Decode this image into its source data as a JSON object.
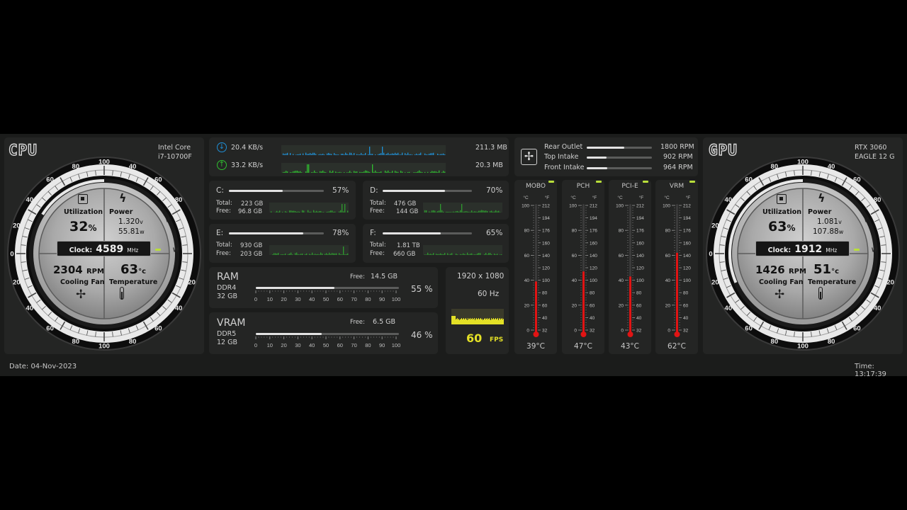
{
  "cpu": {
    "logo": "CPU",
    "model_line1": "Intel Core",
    "model_line2": "i7-10700F",
    "util_label": "Utilization",
    "util_value": "32",
    "util_unit": "%",
    "util_fraction": 0.32,
    "power_label": "Power",
    "voltage": "1.320",
    "voltage_unit": "v",
    "watts": "55.81",
    "watts_unit": "w",
    "clock_label": "Clock:",
    "clock_value": "4589",
    "clock_unit": "MHz",
    "fan_value": "2304",
    "fan_unit": "RPM",
    "fan_label": "Cooling Fan",
    "temp_value": "63",
    "temp_unit": "°c",
    "temp_label": "Temperature",
    "scale_left": [
      "100",
      "80",
      "60",
      "40",
      "20",
      "0",
      "20",
      "40",
      "60",
      "80",
      "100"
    ],
    "scale_right": [
      "40",
      "60",
      "80",
      "100",
      "20",
      "40",
      "60",
      "80",
      "100"
    ],
    "marker_v": "V",
    "marker_w": "W"
  },
  "gpu": {
    "logo": "GPU",
    "model_line1": "RTX 3060",
    "model_line2": "EAGLE 12 G",
    "util_label": "Utilization",
    "util_value": "63",
    "util_unit": "%",
    "util_fraction": 0.63,
    "power_label": "Power",
    "voltage": "1.081",
    "voltage_unit": "v",
    "watts": "107.88",
    "watts_unit": "w",
    "clock_label": "Clock:",
    "clock_value": "1912",
    "clock_unit": "MHz",
    "fan_value": "1426",
    "fan_unit": "RPM",
    "fan_label": "Cooling Fan",
    "temp_value": "51",
    "temp_unit": "°c",
    "temp_label": "Temperature",
    "marker_v": "V",
    "marker_w": "W"
  },
  "network": {
    "download_speed": "20.4 KB/s",
    "upload_speed": "33.2 KB/s",
    "download_total": "211.3 MB",
    "upload_total": "20.3 MB",
    "download_color": "#1f8fd6",
    "upload_color": "#2fbf2f"
  },
  "drives": [
    {
      "letter": "C:",
      "percent": "57%",
      "fraction": 0.57,
      "total_label": "Total:",
      "free_label": "Free:",
      "total": "223 GB",
      "free": "96.8 GB"
    },
    {
      "letter": "D:",
      "percent": "70%",
      "fraction": 0.7,
      "total_label": "Total:",
      "free_label": "Free:",
      "total": "476 GB",
      "free": "144 GB"
    },
    {
      "letter": "E:",
      "percent": "78%",
      "fraction": 0.78,
      "total_label": "Total:",
      "free_label": "Free:",
      "total": "930 GB",
      "free": "203 GB"
    },
    {
      "letter": "F:",
      "percent": "65%",
      "fraction": 0.65,
      "total_label": "Total:",
      "free_label": "Free:",
      "total": "1.81 TB",
      "free": "660 GB"
    }
  ],
  "ram": {
    "title": "RAM",
    "type": "DDR4",
    "size": "32 GB",
    "free_label": "Free:",
    "free": "14.5 GB",
    "percent": "55 %",
    "fraction": 0.55
  },
  "vram": {
    "title": "VRAM",
    "type": "DDR5",
    "size": "12 GB",
    "free_label": "Free:",
    "free": "6.5 GB",
    "percent": "46 %",
    "fraction": 0.46
  },
  "mem_scale": [
    "0",
    "10",
    "20",
    "30",
    "40",
    "50",
    "60",
    "70",
    "80",
    "90",
    "100"
  ],
  "display": {
    "resolution": "1920 x 1080",
    "refresh": "60 Hz",
    "fps_value": "60",
    "fps_label": "FPS",
    "fps_color": "#e3e026"
  },
  "fans": [
    {
      "name": "Rear Outlet",
      "rpm": "1800 RPM",
      "fraction": 0.58
    },
    {
      "name": "Top Intake",
      "rpm": "902 RPM",
      "fraction": 0.3
    },
    {
      "name": "Front Intake",
      "rpm": "964 RPM",
      "fraction": 0.32
    }
  ],
  "thermometers": [
    {
      "name": "MOBO",
      "value": "39°C",
      "celsius": 39
    },
    {
      "name": "PCH",
      "value": "47°C",
      "celsius": 47
    },
    {
      "name": "PCI-E",
      "value": "43°C",
      "celsius": 43
    },
    {
      "name": "VRM",
      "value": "62°C",
      "celsius": 62
    }
  ],
  "therm_units": {
    "c": "°C",
    "f": "°F"
  },
  "therm_c_scale": [
    "100",
    "80",
    "60",
    "40",
    "20",
    "0"
  ],
  "therm_f_scale": [
    "212",
    "194",
    "176",
    "160",
    "140",
    "120",
    "100",
    "80",
    "60",
    "40",
    "32"
  ],
  "footer": {
    "date": "Date: 04-Nov-2023",
    "time": "Time: 13:17:39"
  }
}
